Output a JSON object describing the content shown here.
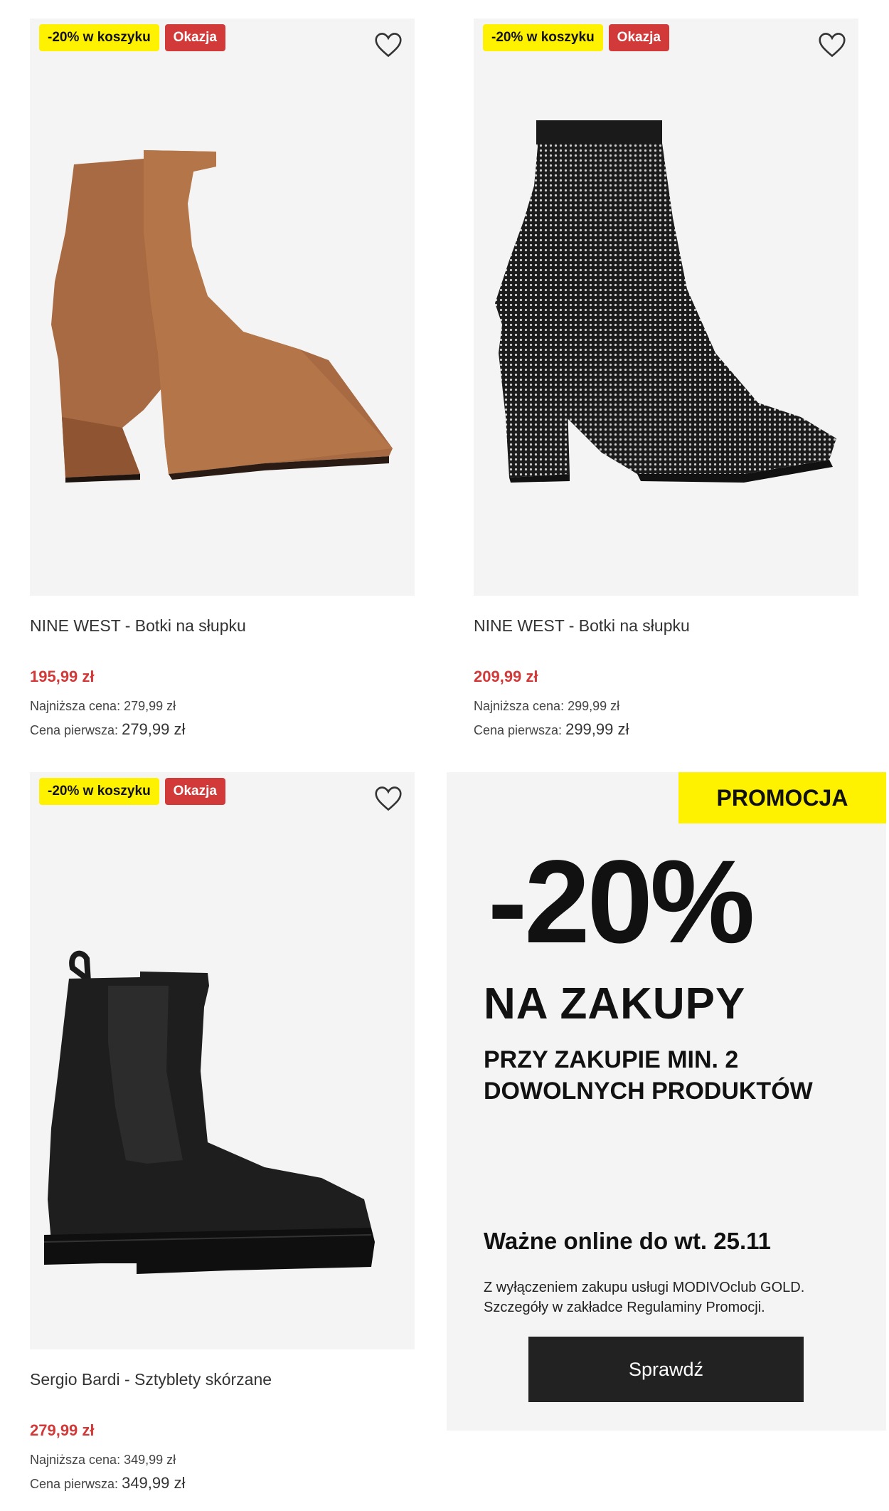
{
  "products": [
    {
      "badge_discount": "-20% w koszyku",
      "badge_sale": "Okazja",
      "name": "NINE WEST - Botki na słupku",
      "price": "195,99 zł",
      "lowest_price": "Najniższa cena: 279,99 zł",
      "first_price_label": "Cena pierwsza:",
      "first_price_value": "279,99 zł",
      "image": "brown-suede-ankle-boot"
    },
    {
      "badge_discount": "-20% w koszyku",
      "badge_sale": "Okazja",
      "name": "NINE WEST - Botki na słupku",
      "price": "209,99 zł",
      "lowest_price": "Najniższa cena: 299,99 zł",
      "first_price_label": "Cena pierwsza:",
      "first_price_value": "299,99 zł",
      "image": "black-rhinestone-sock-boot"
    },
    {
      "badge_discount": "-20% w koszyku",
      "badge_sale": "Okazja",
      "name": "Sergio Bardi - Sztyblety skórzane",
      "price": "279,99 zł",
      "lowest_price": "Najniższa cena: 349,99 zł",
      "first_price_label": "Cena pierwsza:",
      "first_price_value": "349,99 zł",
      "image": "black-leather-chelsea-boot"
    }
  ],
  "promo": {
    "tag": "PROMOCJA",
    "discount": "-20%",
    "headline": "NA ZAKUPY",
    "condition_line1": "PRZY ZAKUPIE MIN. 2",
    "condition_line2": "DOWOLNYCH PRODUKTÓW",
    "valid": "Ważne online do wt. 25.11",
    "fine_line1": "Z wyłączeniem zakupu usługi MODIVOclub GOLD.",
    "fine_line2": "Szczegóły w zakładce Regulaminy Promocji.",
    "button": "Sprawdź"
  },
  "icons": {
    "favorite": "heart-outline-icon"
  },
  "colors": {
    "badge_yellow": "#fff200",
    "sale_red": "#d23a3a",
    "button_dark": "#222222",
    "tile_bg": "#f4f4f4"
  }
}
